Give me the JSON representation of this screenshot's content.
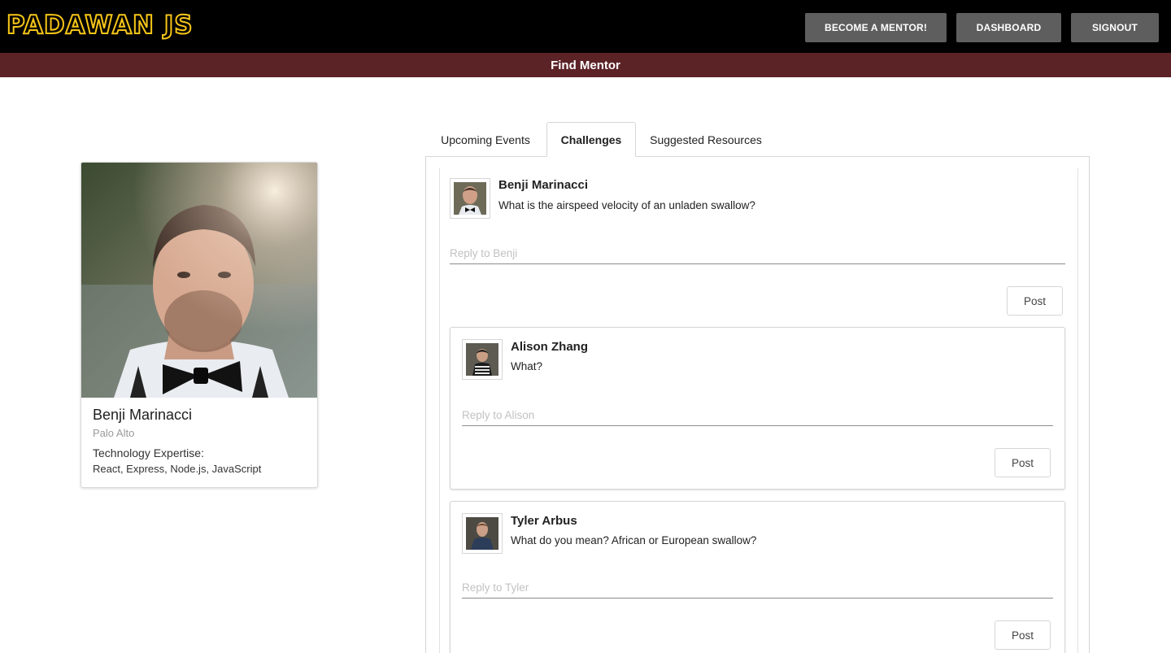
{
  "header": {
    "logo_text": "PADAWAN JS",
    "nav": {
      "become_mentor": "BECOME A MENTOR!",
      "dashboard": "DASHBOARD",
      "signout": "SIGNOUT"
    }
  },
  "subheader": {
    "title": "Find Mentor"
  },
  "profile": {
    "name": "Benji Marinacci",
    "location": "Palo Alto",
    "expertise_label": "Technology Expertise:",
    "expertise": "React, Express, Node.js, JavaScript"
  },
  "tabs": [
    {
      "label": "Upcoming Events",
      "active": false
    },
    {
      "label": "Challenges",
      "active": true
    },
    {
      "label": "Suggested Resources",
      "active": false
    }
  ],
  "challenge": {
    "author": "Benji Marinacci",
    "message": "What is the airspeed velocity of an unladen swallow?",
    "reply_placeholder": "Reply to Benji",
    "post_label": "Post"
  },
  "replies": [
    {
      "author": "Alison Zhang",
      "message": "What?",
      "reply_placeholder": "Reply to Alison",
      "post_label": "Post"
    },
    {
      "author": "Tyler Arbus",
      "message": "What do you mean? African or European swallow?",
      "reply_placeholder": "Reply to Tyler",
      "post_label": "Post"
    }
  ],
  "colors": {
    "header_bg": "#000000",
    "logo_yellow": "#f5c518",
    "nav_button_bg": "#5e5e5e",
    "subheader_bg": "#5c2327"
  }
}
